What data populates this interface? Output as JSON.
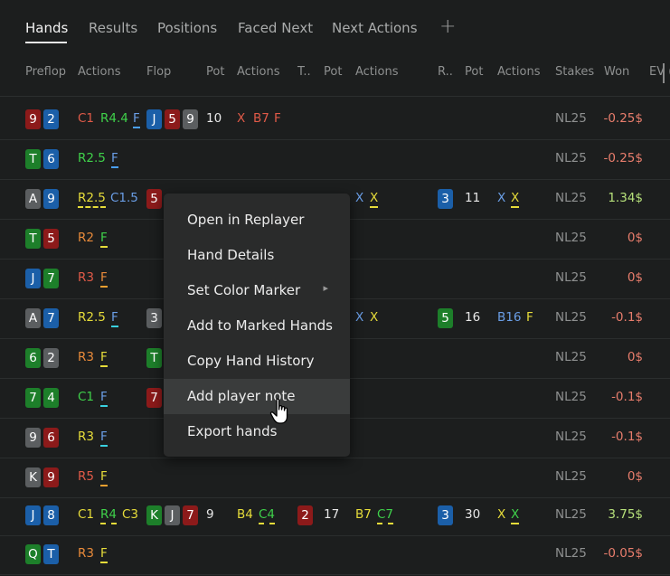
{
  "tabs": [
    "Hands",
    "Results",
    "Positions",
    "Faced Next",
    "Next Actions"
  ],
  "tab_add": "+",
  "headers": [
    "Preflop",
    "Actions",
    "Flop",
    "Pot",
    "Actions",
    "T..",
    "Pot",
    "Actions",
    "R..",
    "Pot",
    "Actions",
    "Stakes",
    "Won",
    "EV ("
  ],
  "rows": [
    {
      "cards": [
        "9",
        "2"
      ],
      "stakes": "NL25",
      "won": "-0.25$"
    },
    {
      "cards": [
        "T",
        "6"
      ],
      "stakes": "NL25",
      "won": "-0.25$"
    },
    {
      "cards": [
        "A",
        "9"
      ],
      "stakes": "NL25",
      "won": "1.34$"
    },
    {
      "cards": [
        "T",
        "5"
      ],
      "stakes": "NL25",
      "won": "0$"
    },
    {
      "cards": [
        "J",
        "7"
      ],
      "stakes": "NL25",
      "won": "0$"
    },
    {
      "cards": [
        "A",
        "7"
      ],
      "stakes": "NL25",
      "won": "-0.1$"
    },
    {
      "cards": [
        "6",
        "2"
      ],
      "stakes": "NL25",
      "won": "0$"
    },
    {
      "cards": [
        "7",
        "4"
      ],
      "stakes": "NL25",
      "won": "-0.1$"
    },
    {
      "cards": [
        "9",
        "6"
      ],
      "stakes": "NL25",
      "won": "-0.1$"
    },
    {
      "cards": [
        "K",
        "9"
      ],
      "stakes": "NL25",
      "won": "0$"
    },
    {
      "cards": [
        "J",
        "8"
      ],
      "stakes": "NL25",
      "won": "3.75$"
    },
    {
      "cards": [
        "Q",
        "T"
      ],
      "stakes": "NL25",
      "won": "-0.05$"
    }
  ],
  "r1": {
    "a1": "C1",
    "a2": "R4.4",
    "a3": "F",
    "flop": [
      "J",
      "5",
      "9"
    ],
    "pot": "10",
    "f1": "X",
    "f2": "B7",
    "f3": "F"
  },
  "r2": {
    "a1": "R2.5",
    "a2": "F"
  },
  "r3": {
    "a1": "R2.5",
    "a2": "C1.5",
    "flop1": "5",
    "t1": "X",
    "t2": "X",
    "river": "3",
    "rpot": "11",
    "r1": "X",
    "r2": "X"
  },
  "r4": {
    "a1": "R2",
    "a2": "F"
  },
  "r5": {
    "a1": "R3",
    "a2": "F"
  },
  "r6": {
    "a1": "R2.5",
    "a2": "F",
    "flop1": "3",
    "t1": "X",
    "t2": "X",
    "river": "5",
    "rpot": "16",
    "r1": "B16",
    "r2": "F"
  },
  "r7": {
    "a1": "R3",
    "a2": "F",
    "flop1": "T"
  },
  "r8": {
    "a1": "C1",
    "a2": "F",
    "flop1": "7"
  },
  "r9": {
    "a1": "R3",
    "a2": "F"
  },
  "r10": {
    "a1": "R5",
    "a2": "F"
  },
  "r11": {
    "a1": "C1",
    "a2": "R4",
    "a3": "C3",
    "flop": [
      "K",
      "J",
      "7"
    ],
    "pot": "9",
    "f1": "B4",
    "f2": "C4",
    "turn": "2",
    "tpot": "17",
    "t1": "B7",
    "t2": "C7",
    "river": "3",
    "rpot": "30",
    "r1": "X",
    "r2": "X"
  },
  "r12": {
    "a1": "R3",
    "a2": "F"
  },
  "menu": {
    "items": [
      "Open in Replayer",
      "Hand Details",
      "Set Color Marker",
      "Add to Marked Hands",
      "Copy Hand History",
      "Add player note",
      "Export hands"
    ],
    "submenu_arrow": "▸"
  }
}
